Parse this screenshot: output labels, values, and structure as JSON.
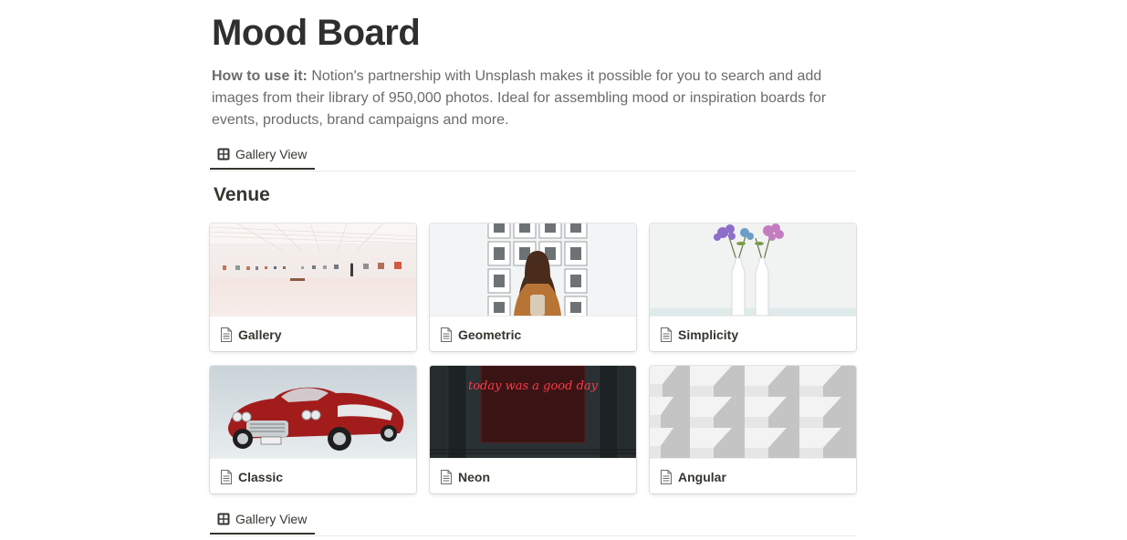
{
  "page": {
    "title": "Mood Board",
    "description_bold": "How to use it:",
    "description_text": " Notion's partnership with Unsplash makes it possible for you to search and add images from their library of 950,000 photos. Ideal for assembling mood or inspiration boards for events, products, brand campaigns and more."
  },
  "views": [
    {
      "label": "Gallery View",
      "icon": "gallery-grid-icon"
    },
    {
      "label": "Gallery View",
      "icon": "gallery-grid-icon"
    }
  ],
  "section": {
    "heading": "Venue"
  },
  "cards": [
    {
      "label": "Gallery",
      "icon": "page-icon",
      "cover": "white art gallery hall"
    },
    {
      "label": "Geometric",
      "icon": "page-icon",
      "cover": "woman viewing framed photos"
    },
    {
      "label": "Simplicity",
      "icon": "page-icon",
      "cover": "white vases with purple flowers"
    },
    {
      "label": "Classic",
      "icon": "page-icon",
      "cover": "red vintage convertible car"
    },
    {
      "label": "Neon",
      "icon": "page-icon",
      "cover": "red neon sign on dark wall"
    },
    {
      "label": "Angular",
      "icon": "page-icon",
      "cover": "white angular architecture"
    }
  ],
  "neon_sign_text": "today was a good day",
  "colors": {
    "text": "#37352f",
    "muted": "#6b6b6b",
    "divider": "#e9e9e7",
    "neon": "#ff3a4a"
  }
}
